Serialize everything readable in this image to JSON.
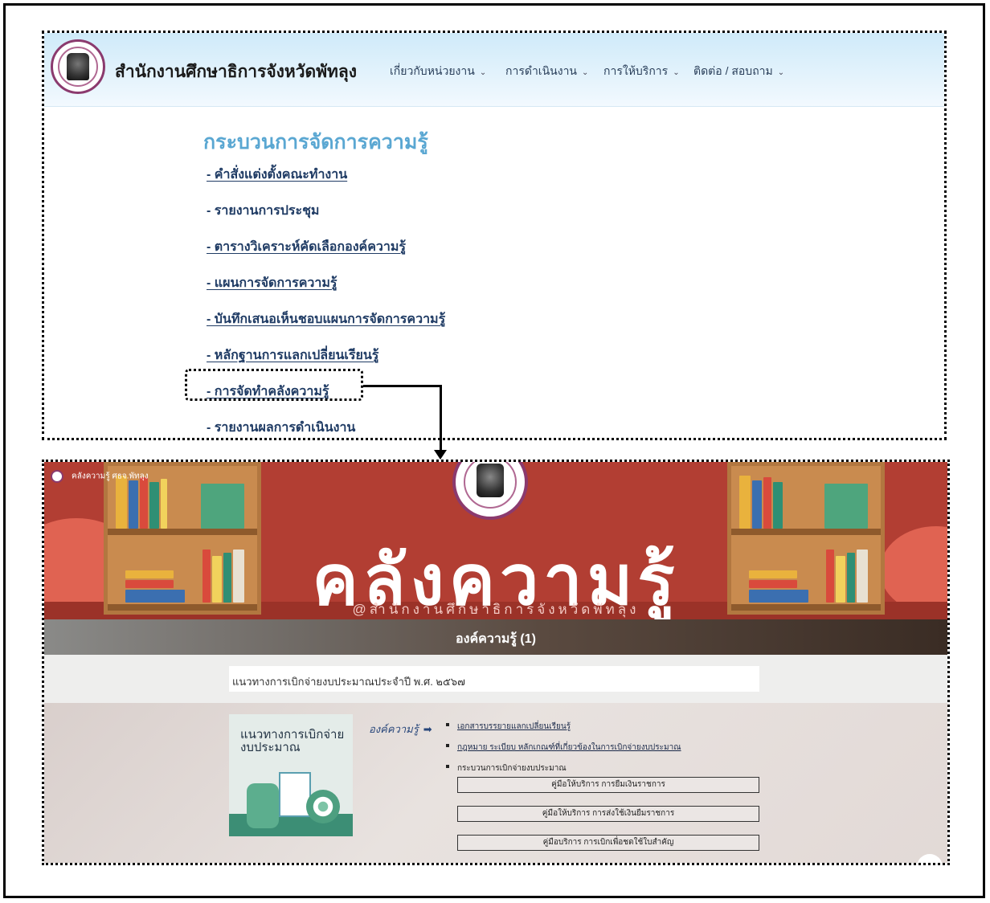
{
  "header": {
    "site_title": "สำนักงานศึกษาธิการจังหวัดพัทลุง",
    "nav": [
      {
        "label": "เกี่ยวกับหน่วยงาน"
      },
      {
        "label": "การดำเนินงาน"
      },
      {
        "label": "การให้บริการ"
      },
      {
        "label": "ติดต่อ / สอบถาม"
      }
    ]
  },
  "content": {
    "title": "กระบวนการจัดการความรู้",
    "links": [
      {
        "label": "- คำสั่งแต่งตั้งคณะทำงาน",
        "underlined": true
      },
      {
        "label": "- รายงานการประชุม",
        "underlined": false
      },
      {
        "label": "- ตารางวิเคราะห์คัดเลือกองค์ความรู้",
        "underlined": true
      },
      {
        "label": "- แผนการจัดการความรู้",
        "underlined": true
      },
      {
        "label": "- บันทึกเสนอเห็นชอบแผนการจัดการความรู้",
        "underlined": true
      },
      {
        "label": "- หลักฐานการแลกเปลี่ยนเรียนรู้",
        "underlined": true
      },
      {
        "label": "- การจัดทำคลังความรู้",
        "underlined": true,
        "highlighted": true
      },
      {
        "label": "- รายงานผลการดำเนินงาน",
        "underlined": false
      }
    ]
  },
  "knowledge_page": {
    "brand": "คลังความรู้ ศธจ.พัทลุง",
    "banner_title": "คลังความรู้",
    "banner_subtitle": "@สำนักงานศึกษาธิการจังหวัดพัทลุง",
    "section_title": "องค์ความรู้ (1)",
    "card_title": "แนวทางการเบิกจ่ายงบประมาณประจำปี พ.ศ. ๒๕๖๗",
    "thumbnail_text": "แนวทางการเบิกจ่าย\nงบประมาณ",
    "ok_label": "องค์ความรู้",
    "ok_arrow": "➡",
    "bullets": [
      {
        "label": "เอกสารบรรยายแลกเปลี่ยนเรียนรู้",
        "underlined": true
      },
      {
        "label": "กฎหมาย ระเบียบ หลักเกณฑ์ที่เกี่ยวข้องในการเบิกจ่ายงบประมาณ",
        "underlined": true
      },
      {
        "label": "กระบวนการเบิกจ่ายงบประมาณ",
        "underlined": false
      }
    ],
    "buttons": [
      {
        "label": "คู่มือให้บริการ การยืมเงินราชการ"
      },
      {
        "label": "คู่มือให้บริการ การส่งใช้เงินยืมราชการ"
      },
      {
        "label": "คู่มือบริการ การเบิกเพื่อชดใช้ใบสำคัญ"
      }
    ]
  },
  "colors": {
    "header_bg": "#cfeaf9",
    "title_blue": "#5aa7d2",
    "link_navy": "#1f3b64",
    "banner_red": "#b23e33",
    "shelf_wood": "#c98b4f"
  }
}
